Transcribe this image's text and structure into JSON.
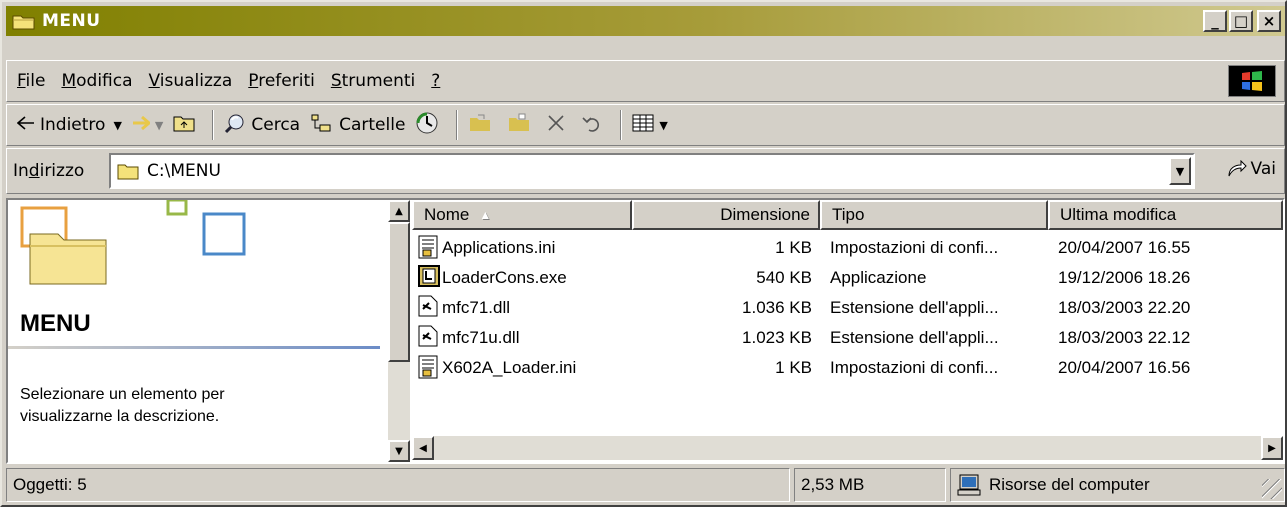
{
  "window": {
    "title": "MENU"
  },
  "titlebar_buttons": {
    "minimize": "_",
    "maximize": "□",
    "close": "×"
  },
  "menu": {
    "items": [
      {
        "label": "File",
        "u": "F",
        "rest": "ile"
      },
      {
        "label": "Modifica",
        "u": "M",
        "rest": "odifica"
      },
      {
        "label": "Visualizza",
        "u": "V",
        "rest": "isualizza"
      },
      {
        "label": "Preferiti",
        "u": "P",
        "rest": "referiti"
      },
      {
        "label": "Strumenti",
        "u": "S",
        "rest": "trumenti"
      },
      {
        "label": "?",
        "u": "?",
        "rest": ""
      }
    ]
  },
  "toolbar": {
    "back": "Indietro",
    "search": "Cerca",
    "folders": "Cartelle"
  },
  "address": {
    "label_pre": "In",
    "label_u": "d",
    "label_post": "irizzo",
    "value": "C:\\MENU",
    "go": "Vai"
  },
  "left_pane": {
    "title": "MENU",
    "description_line1": "Selezionare un elemento per",
    "description_line2": "visualizzarne la descrizione."
  },
  "columns": [
    "Nome",
    "Dimensione",
    "Tipo",
    "Ultima modifica"
  ],
  "files": [
    {
      "name": "Applications.ini",
      "size": "1 KB",
      "type": "Impostazioni di confi...",
      "modified": "20/04/2007 16.55",
      "icon": "ini-file-icon"
    },
    {
      "name": "LoaderCons.exe",
      "size": "540 KB",
      "type": "Applicazione",
      "modified": "19/12/2006 18.26",
      "icon": "exe-file-icon"
    },
    {
      "name": "mfc71.dll",
      "size": "1.036 KB",
      "type": "Estensione dell'appli...",
      "modified": "18/03/2003 22.20",
      "icon": "dll-file-icon"
    },
    {
      "name": "mfc71u.dll",
      "size": "1.023 KB",
      "type": "Estensione dell'appli...",
      "modified": "18/03/2003 22.12",
      "icon": "dll-file-icon"
    },
    {
      "name": "X602A_Loader.ini",
      "size": "1 KB",
      "type": "Impostazioni di confi...",
      "modified": "20/04/2007 16.56",
      "icon": "ini-file-icon"
    }
  ],
  "status": {
    "objects": "Oggetti: 5",
    "size": "2,53 MB",
    "zone": "Risorse del computer"
  },
  "colors": {
    "titlebar_start": "#808000",
    "titlebar_end": "#d0c990",
    "chrome": "#d4d0c8"
  }
}
